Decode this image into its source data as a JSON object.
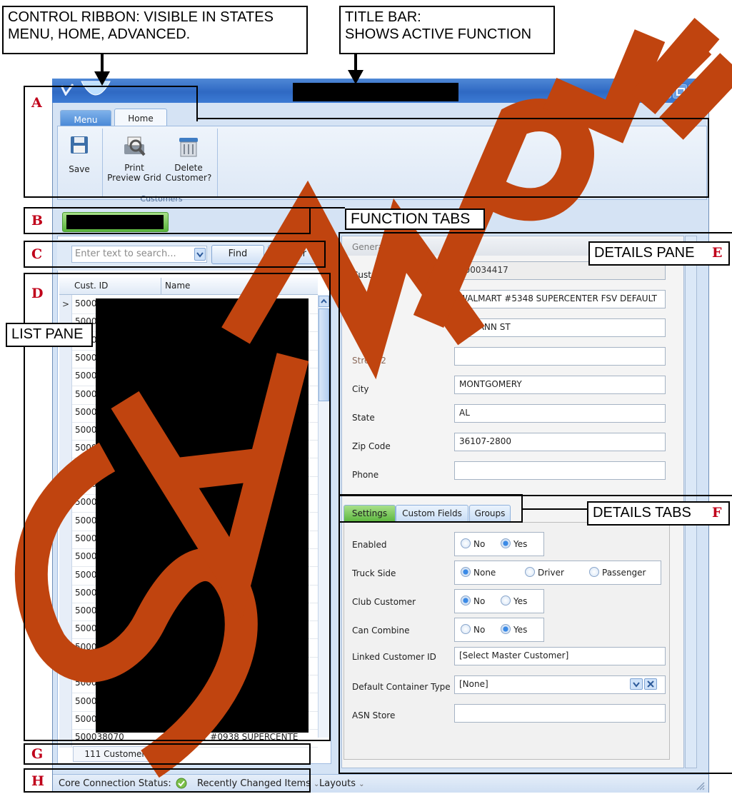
{
  "callouts": {
    "ribbon_line1": "CONTROL RIBBON: VISIBLE IN STATES",
    "ribbon_line2": "MENU, HOME, ADVANCED.",
    "title_line1": "TITLE BAR:",
    "title_line2": "SHOWS ACTIVE FUNCTION",
    "function_tabs": "FUNCTION TABS",
    "list_pane": "LIST PANE",
    "details_pane": "DETAILS PANE",
    "details_tabs": "DETAILS TABS"
  },
  "letters": [
    "A",
    "B",
    "C",
    "D",
    "E",
    "F",
    "G",
    "H"
  ],
  "ribbon": {
    "tabs": [
      "Menu",
      "Home"
    ],
    "save": "Save",
    "print_line1": "Print",
    "print_line2": "Preview Grid",
    "delete_line1": "Delete",
    "delete_line2": "Customer?",
    "group_label": "Customers"
  },
  "search": {
    "placeholder": "Enter text to search...",
    "find": "Find",
    "clear": "Clear"
  },
  "grid": {
    "columns": [
      "Cust. ID",
      "Name"
    ],
    "rows": [
      "5000",
      "5000",
      "5000",
      "5000",
      "5000",
      "5000",
      "5000",
      "5000",
      "5000",
      "5000",
      "5000",
      "5000",
      "5000",
      "5000",
      "5000",
      "5000",
      "5000",
      "5000",
      "5000",
      "5000",
      "5000",
      "5000",
      "5000",
      "5000"
    ],
    "last_row_id": "500038070",
    "last_row_name": "WALMART #0938 SUPERCENTE",
    "footer": "111 Customers"
  },
  "details": {
    "section": "General",
    "fields": [
      {
        "label": "Customer ID",
        "value": "500034417"
      },
      {
        "label": "Name",
        "value": "WALMART #5348 SUPERCENTER FSV DEFAULT"
      },
      {
        "label": "Street 1",
        "value": "851 ANN ST"
      },
      {
        "label": "Street 2",
        "value": ""
      },
      {
        "label": "City",
        "value": "MONTGOMERY"
      },
      {
        "label": "State",
        "value": "AL"
      },
      {
        "label": "Zip Code",
        "value": "36107-2800"
      },
      {
        "label": "Phone",
        "value": ""
      }
    ],
    "tabs": [
      "Settings",
      "Custom Fields",
      "Groups"
    ],
    "settings": {
      "enabled_label": "Enabled",
      "truck_side_label": "Truck Side",
      "club_label": "Club Customer",
      "combine_label": "Can Combine",
      "linked_label": "Linked Customer ID",
      "linked_value": "[Select Master Customer]",
      "container_label": "Default Container Type",
      "container_value": "[None]",
      "asn_label": "ASN Store",
      "no": "No",
      "yes": "Yes",
      "none": "None",
      "driver": "Driver",
      "passenger": "Passenger"
    }
  },
  "status": {
    "connection": "Core Connection Status:",
    "recent": "Recently Changed Items",
    "layouts": "Layouts"
  },
  "colors": {
    "accent_green": "#58b43a",
    "title_blue": "#2f69c3",
    "annotation_red": "#c0001a",
    "watermark": "#c0440f"
  }
}
